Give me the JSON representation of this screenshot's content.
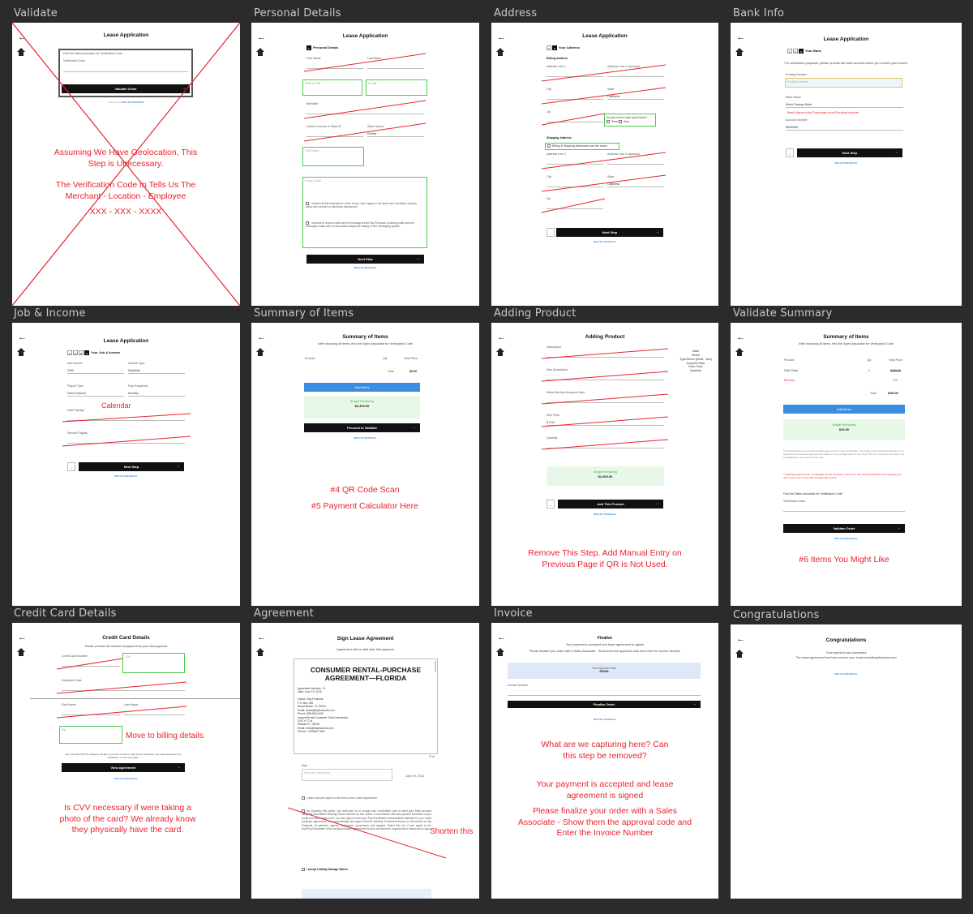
{
  "colors": {
    "annotation": "#e8232d",
    "background": "#2b2b2b",
    "accent": "#3b8de0",
    "success": "#4ec94e"
  },
  "frames": {
    "validate": {
      "label": "Validate",
      "title": "Lease Application",
      "instruction": "Find the Sales Associate for Verification Code",
      "field_label": "Verification Code",
      "button": "Validate Order",
      "powered": "Powered by",
      "logo": "MOLLIE FINANCIAL",
      "note1": "Assuming We Have Geolocation, This Step is Unecessary.",
      "note2": "The Verification Code In Tells Us The Merchant - Location - Employee",
      "note3": "XXX - XXX - XXXX"
    },
    "personal": {
      "label": "Personal Details",
      "title": "Lease Application",
      "step": "Personal Details",
      "first": "First Name",
      "last": "Last Name",
      "ssn": "SSN or ITIN",
      "email": "E-mail",
      "birthdate": "Birthdate",
      "id": "Drivers License or State ID",
      "state": "State Issued",
      "state_val": "Florida",
      "phone": "Cell Phone",
      "promo": "Promo Code",
      "promo_ph": "Promo Code",
      "button": "Next Step",
      "logo": "MOLLIE FINANCIAL"
    },
    "address": {
      "label": "Address",
      "title": "Lease Application",
      "step": "Your Address",
      "billing": "Billing Address",
      "line1": "Address Line 1",
      "line2": "Address Line 2 (optional)",
      "city": "City",
      "state": "State",
      "state_val": "California",
      "zip": "Zip",
      "rent_q": "Do you rent or own your home?",
      "rent": "Rent",
      "own": "Own",
      "shipping": "Shipping Address",
      "same": "Billing & Shipping Addresses are the same",
      "button": "Next Step",
      "logo": "MOLLIE FINANCIAL"
    },
    "bank": {
      "label": "Bank Info",
      "title": "Lease Application",
      "step": "Your Bank",
      "sub": "For verification purposes, please provide the bank account where you receive your income",
      "routing": "Routing Number",
      "bank_name": "Bank Name",
      "bank_val": "World Savings Bank",
      "note": "Bank Name Auto Populates from Routing Number",
      "account": "Account Number",
      "account_val": "98430987",
      "button": "Next Step",
      "logo": "MOLLIE FINANCIAL"
    },
    "job": {
      "label": "Job & Income",
      "title": "Lease Application",
      "step": "Your Job & Income",
      "net": "Net Income",
      "net_val": "2500",
      "type": "Income Type",
      "type_val": "Disability",
      "payroll": "Payroll Type",
      "payroll_val": "Direct Deposit",
      "freq": "Pay Frequency",
      "freq_val": "Monthly",
      "note": "Calendar",
      "next_pay": "Next Payday",
      "second_pay": "Second Payday",
      "button": "Next Step",
      "logo": "MOLLIE FINANCIAL"
    },
    "summary": {
      "label": "Summary of Items",
      "title": "Summary of Items",
      "sub": "After choosing all items, find the Sales Associate for Verification Code",
      "col1": "Product",
      "col2": "Qty",
      "col3": "Total Price",
      "total_lbl": "Total",
      "total": "$0.00",
      "add": "Add Items",
      "budget_lbl": "Budget Remaining",
      "budget": "$2,300.00",
      "button": "Proceed to Validate",
      "logo": "MOLLIE FINANCIAL",
      "note1": "#4 QR Code Scan",
      "note2": "#5 Payment Calculator Here"
    },
    "adding": {
      "label": "Adding Product",
      "title": "Adding Product",
      "side": [
        "Make",
        "Model",
        "Type/Series (Beds - Box)",
        "Acquired Date",
        "Each Price",
        "Quantity"
      ],
      "f1": "Description",
      "f2": "Item Description",
      "f3": "Model Number/Acquired Date",
      "f4": "Item Price",
      "f4_val": "$ 0.00",
      "f5": "Quantity",
      "budget_lbl": "Budget Remaining",
      "budget": "$2,300.00",
      "button": "Add This Product",
      "logo": "MOLLIE FINANCIAL",
      "note": "Remove This Step. Add Manual Entry on Previous Page if QR is Not Used."
    },
    "vsummary": {
      "label": "Validate Summary",
      "title": "Summary of Items",
      "sub": "After choosing all items, find the Sales Associate for Verification Code",
      "col1": "Product",
      "col2": "Qty",
      "col3": "Total Price",
      "item": "Club Chair",
      "item_qty": "1",
      "item_price": "$290.00",
      "remove": "Remove",
      "edit": "Edit",
      "total_lbl": "Total",
      "total": "$290.00",
      "add": "Add Items",
      "budget_lbl": "Budget Remaining",
      "budget": "$10.00",
      "vc_lbl": "Find the Sales Associate for Verification Code",
      "vc_field": "Verification Code",
      "button": "Validate Order",
      "logo": "MOLLIE FINANCIAL",
      "note": "#6 Items You Might Like"
    },
    "credit": {
      "label": "Credit Card Details",
      "title": "Credit Card Details",
      "sub": "Please provide the method of payment for your first payment",
      "card": "Credit Card Number",
      "cvv": "CVV",
      "exp": "Expiration Date",
      "first": "First Name",
      "last": "Last Name",
      "zip": "Zip",
      "fine": "Your card will NOT be charged until after you have reviewed, signed and submitted your lease agreement for finalization on the next page.",
      "button": "View Agreement",
      "logo": "MOLLIE FINANCIAL",
      "note1": "Move to billing details.",
      "note2": "Is CVV necessary if were taking a photo of the card? We already know they physically have the card."
    },
    "agreement": {
      "label": "Agreement",
      "title": "Sign Lease Agreement",
      "sub": "Agreement will be valid after first payment",
      "doc_title1": "CONSUMER RENTAL-PURCHASE",
      "doc_title2": "AGREEMENT—FLORIDA",
      "doc_lines": [
        "Agreement Number: 74",
        "Date: June 19, 2018",
        "",
        "Lessor: Sky Financial",
        "P.O. Box 185",
        "Stuart Beach, FL 33004",
        "Email: lease@skyfinancial.com",
        "Phone: 888-682-6100",
        "Lessee/Rental Customer: Erick Hernandez",
        "2167 e 77 pl",
        "Hialeah FL, 33016",
        "Email: erick@skyfinancial.com",
        "Phone: +13054677509"
      ],
      "print": "Print",
      "sign_lbl": "Sign",
      "sign_ph": "First and Last Name",
      "date": "June 19, 2018",
      "agree": "I have read and agree to the terms of the Lease Agreement.",
      "autopay": "By choosing this option, you authorize us to charge your credit/debit card or debit your bank account using the Automated Clearing House network for this Lease, in accordance with the payment schedule in your rental purchase agreement. You also agree to the Auto Pay Enrollment authorizations attached to your rental purchase agreement. You acknowledge and agree that the AutoPay Enrollment enures to the benefit of Sky Financial, its partners, agents, employees, successors and assigns. Select this box if you agree to the AutoPay Enrollment in the rental purchase agreement that you will have the opportunity to review and e-sign.",
      "waiver": "I accept Liability Damage Waiver",
      "note": "Shorten this"
    },
    "invoice": {
      "label": "Invoice",
      "title": "Finalize",
      "sub1": "Your payment is accepted and lease agreement is signed",
      "sub2": "Please finalize your order with a Sales Associate - Show them the approval code and enter the Invoice Number",
      "code_lbl": "Your Approval Code",
      "code": "000000",
      "inv_lbl": "Invoice Number",
      "button": "Finalize Order",
      "logo": "MOLLIE FINANCIAL",
      "note1": "What are we capturing here? Can this step be removed?",
      "note2": "Your payment is accepted and lease agreement is signed",
      "note3": "Please finalize your order with a Sales Associate - Show them the approval code and Enter the Invoice Number"
    },
    "congrats": {
      "label": "Congratulations",
      "title": "Congratulations",
      "sub1": "Your payment was successful",
      "sub2": "The lease agreement has been sent to your email erick@skyfinancial.com",
      "logo": "MOLLIE FINANCIAL"
    }
  }
}
